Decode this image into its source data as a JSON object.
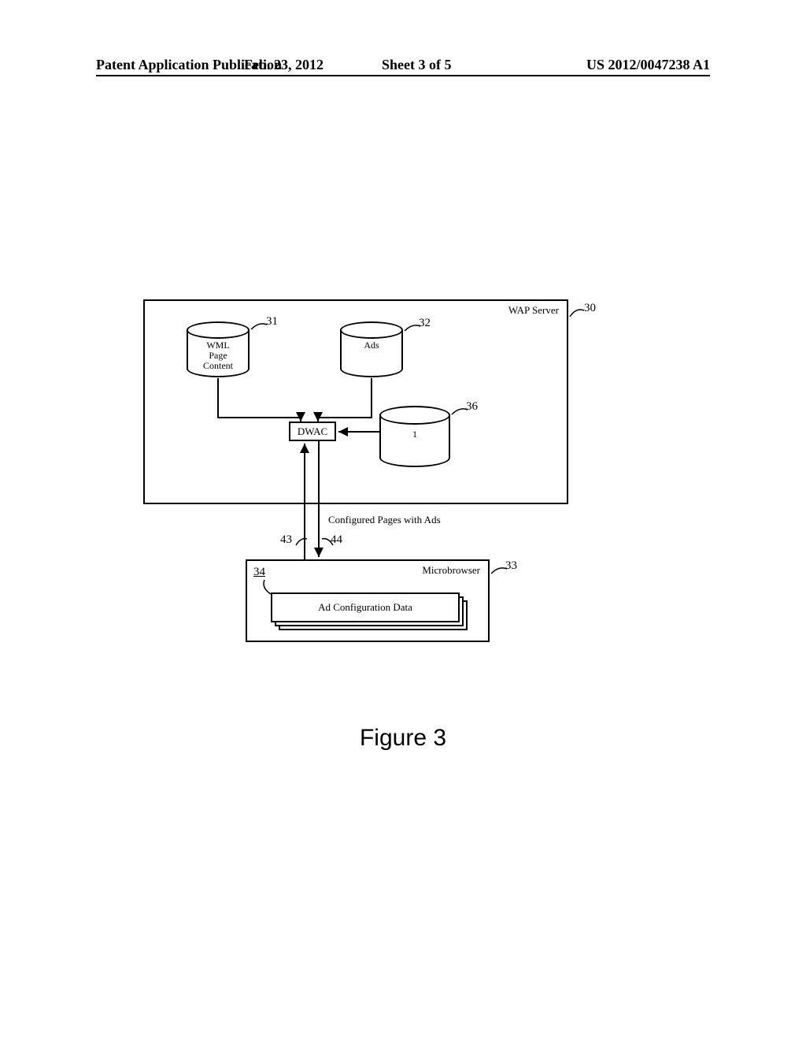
{
  "header": {
    "left": "Patent Application Publication",
    "date": "Feb. 23, 2012",
    "sheet": "Sheet 3 of 5",
    "pubno": "US 2012/0047238 A1"
  },
  "diagram": {
    "server_label": "WAP Server",
    "db_wml": "WML\nPage\nContent",
    "db_ads": "Ads",
    "db_x": "1",
    "dwac": "DWAC",
    "msg": "Configured Pages with Ads",
    "micro_label": "Microbrowser",
    "acd": "Ad Configuration Data",
    "refs": {
      "r30": "30",
      "r31": "31",
      "r32": "32",
      "r33": "33",
      "r34": "34",
      "r36": "36",
      "r43": "43",
      "r44": "44"
    }
  },
  "figure_caption": "Figure 3"
}
